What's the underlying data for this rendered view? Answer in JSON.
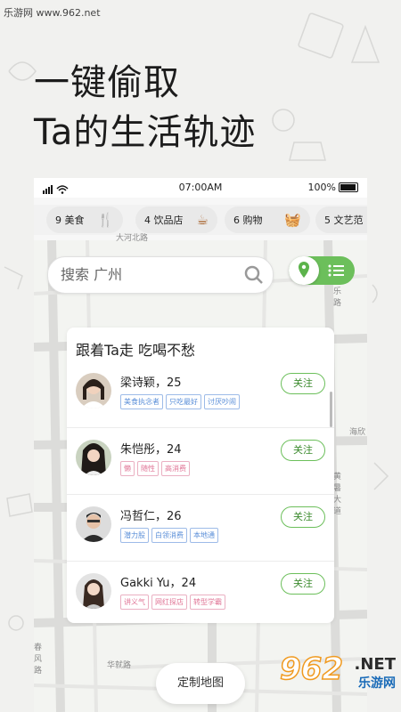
{
  "watermark": "乐游网 www.962.net",
  "headline": {
    "line1": "一键偷取",
    "line2": "Ta的生活轨迹"
  },
  "status_bar": {
    "time": "07:00AM",
    "battery": "100%"
  },
  "categories": [
    {
      "label": "9 美食",
      "icon": "fork-knife-icon",
      "glyph": "🍴",
      "color": "#e45a4c"
    },
    {
      "label": "4 饮品店",
      "icon": "coffee-cup-icon",
      "glyph": "☕",
      "color": "#a35a1f"
    },
    {
      "label": "6 购物",
      "icon": "basket-icon",
      "glyph": "🧺",
      "color": "#4aa04a"
    },
    {
      "label": "5 文艺范",
      "icon": "",
      "glyph": "",
      "color": "#888888"
    }
  ],
  "map_labels": [
    "大河北路",
    "乐路",
    "海欣",
    "黄暑大道",
    "华就路",
    "春风路",
    "路"
  ],
  "search": {
    "placeholder": "搜索 广州"
  },
  "card": {
    "title": "跟着Ta走  吃喝不愁",
    "people": [
      {
        "name": "梁诗颖",
        "age": "25",
        "tags": [
          "美食执念者",
          "只吃最好",
          "讨厌吵闹"
        ],
        "tag_style": "blue",
        "follow": "关注"
      },
      {
        "name": "朱恺彤",
        "age": "24",
        "tags": [
          "懒",
          "随性",
          "高消费"
        ],
        "tag_style": "pink",
        "follow": "关注"
      },
      {
        "name": "冯哲仁",
        "age": "26",
        "tags": [
          "潜力股",
          "白领消费",
          "本地通"
        ],
        "tag_style": "blue",
        "follow": "关注"
      },
      {
        "name": "Gakki Yu",
        "age": "24",
        "tags": [
          "讲义气",
          "网红探店",
          "转型学霸"
        ],
        "tag_style": "pink",
        "follow": "关注"
      }
    ]
  },
  "custom_map_button": "定制地图",
  "logo": {
    "number": "962",
    "net": ".NET",
    "cn": "乐游网"
  }
}
